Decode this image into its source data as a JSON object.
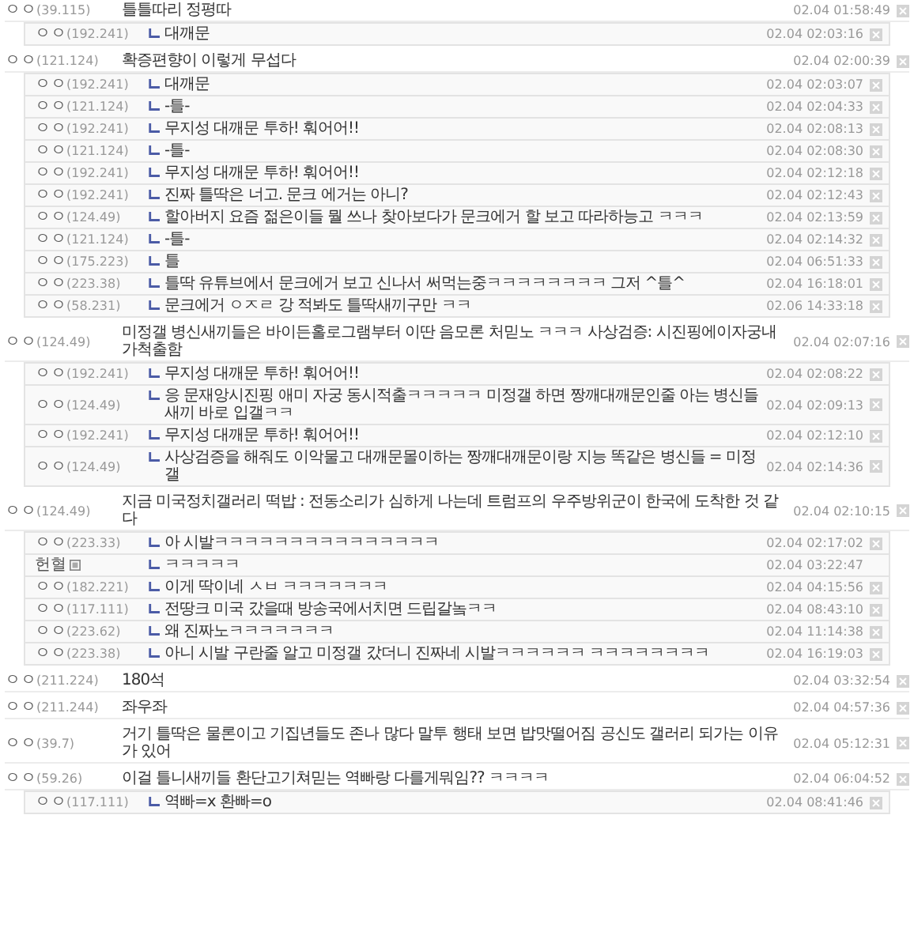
{
  "threads": [
    {
      "author": "ㅇㅇ",
      "ip": "(39.115)",
      "text": "틀틀따리 정평따",
      "time": "02.04 01:58:49",
      "deletable": true,
      "replies": [
        {
          "author": "ㅇㅇ",
          "ip": "(192.241)",
          "text": "대깨문",
          "time": "02.04 02:03:16",
          "deletable": true
        }
      ]
    },
    {
      "author": "ㅇㅇ",
      "ip": "(121.124)",
      "text": "확증편향이 이렇게 무섭다",
      "time": "02.04 02:00:39",
      "deletable": true,
      "replies": [
        {
          "author": "ㅇㅇ",
          "ip": "(192.241)",
          "text": "대깨문",
          "time": "02.04 02:03:07",
          "deletable": true
        },
        {
          "author": "ㅇㅇ",
          "ip": "(121.124)",
          "text": "-틀-",
          "time": "02.04 02:04:33",
          "deletable": true
        },
        {
          "author": "ㅇㅇ",
          "ip": "(192.241)",
          "text": "무지성 대깨문 투하! 훠어어!!",
          "time": "02.04 02:08:13",
          "deletable": true
        },
        {
          "author": "ㅇㅇ",
          "ip": "(121.124)",
          "text": "-틀-",
          "time": "02.04 02:08:30",
          "deletable": true
        },
        {
          "author": "ㅇㅇ",
          "ip": "(192.241)",
          "text": "무지성 대깨문 투하! 훠어어!!",
          "time": "02.04 02:12:18",
          "deletable": true
        },
        {
          "author": "ㅇㅇ",
          "ip": "(192.241)",
          "text": "진짜 틀딱은 너고. 문크 에거는 아니?",
          "time": "02.04 02:12:43",
          "deletable": true
        },
        {
          "author": "ㅇㅇ",
          "ip": "(124.49)",
          "text": "할아버지 요즘 젊은이들 뭘 쓰나 찾아보다가 문크에거 할 보고 따라하능고 ㅋㅋㅋ",
          "time": "02.04 02:13:59",
          "deletable": true
        },
        {
          "author": "ㅇㅇ",
          "ip": "(121.124)",
          "text": "-틀-",
          "time": "02.04 02:14:32",
          "deletable": true
        },
        {
          "author": "ㅇㅇ",
          "ip": "(175.223)",
          "text": "틀",
          "time": "02.04 06:51:33",
          "deletable": true
        },
        {
          "author": "ㅇㅇ",
          "ip": "(223.38)",
          "text": "틀딱 유튜브에서 문크에거 보고 신나서 써먹는중ㅋㅋㅋㅋㅋㅋㅋㅋ 그저 ^틀^",
          "time": "02.04 16:18:01",
          "deletable": true
        },
        {
          "author": "ㅇㅇ",
          "ip": "(58.231)",
          "text": "문크에거 ㅇㅈㄹ 강 적봐도 틀딱새끼구만 ㅋㅋ",
          "time": "02.06 14:33:18",
          "deletable": true
        }
      ]
    },
    {
      "author": "ㅇㅇ",
      "ip": "(124.49)",
      "text": "미정갤 병신새끼들은 바이든홀로그램부터 이딴 음모론 처믿노 ㅋㅋㅋ 사상검증: 시진핑에이자궁내가척출함",
      "time": "02.04 02:07:16",
      "deletable": true,
      "replies": [
        {
          "author": "ㅇㅇ",
          "ip": "(192.241)",
          "text": "무지성 대깨문 투하! 훠어어!!",
          "time": "02.04 02:08:22",
          "deletable": true
        },
        {
          "author": "ㅇㅇ",
          "ip": "(124.49)",
          "text": "응 문재앙시진핑 애미 자궁 동시적출ㅋㅋㅋㅋㅋ 미정갤 하면 짱깨대깨문인줄 아는 병신들새끼 바로 입갤ㅋㅋ",
          "time": "02.04 02:09:13",
          "deletable": true
        },
        {
          "author": "ㅇㅇ",
          "ip": "(192.241)",
          "text": "무지성 대깨문 투하! 훠어어!!",
          "time": "02.04 02:12:10",
          "deletable": true
        },
        {
          "author": "ㅇㅇ",
          "ip": "(124.49)",
          "text": "사상검증을 해줘도 이악물고 대깨문몰이하는 짱깨대깨문이랑 지능 똑같은 병신들 = 미정갤",
          "time": "02.04 02:14:36",
          "deletable": true
        }
      ]
    },
    {
      "author": "ㅇㅇ",
      "ip": "(124.49)",
      "text": "지금 미국정치갤러리 떡밥 : 전동소리가 심하게 나는데 트럼프의 우주방위군이 한국에 도착한 것 같다",
      "time": "02.04 02:10:15",
      "deletable": true,
      "replies": [
        {
          "author": "ㅇㅇ",
          "ip": "(223.33)",
          "text": "아 시발ㅋㅋㅋㅋㅋㅋㅋㅋㅋㅋㅋㅋㅋㅋㅋ",
          "time": "02.04 02:17:02",
          "deletable": true
        },
        {
          "author": "헌혈",
          "nick_icon": true,
          "text": "ㅋㅋㅋㅋㅋ",
          "time": "02.04 03:22:47",
          "deletable": false
        },
        {
          "author": "ㅇㅇ",
          "ip": "(182.221)",
          "text": "이게 딱이네 ㅅㅂ ㅋㅋㅋㅋㅋㅋㅋ",
          "time": "02.04 04:15:56",
          "deletable": true
        },
        {
          "author": "ㅇㅇ",
          "ip": "(117.111)",
          "text": "전땅크 미국 갔을때 방송국에서치면 드립갈놐ㅋㅋ",
          "time": "02.04 08:43:10",
          "deletable": true
        },
        {
          "author": "ㅇㅇ",
          "ip": "(223.62)",
          "text": "왜 진짜노ㅋㅋㅋㅋㅋㅋㅋ",
          "time": "02.04 11:14:38",
          "deletable": true
        },
        {
          "author": "ㅇㅇ",
          "ip": "(223.38)",
          "text": "아니 시발 구란줄 알고 미정갤 갔더니 진짜네 시발ㅋㅋㅋㅋㅋㅋ ㅋㅋㅋㅋㅋㅋㅋㅋ",
          "time": "02.04 16:19:03",
          "deletable": true
        }
      ]
    },
    {
      "author": "ㅇㅇ",
      "ip": "(211.224)",
      "text": "180석",
      "time": "02.04 03:32:54",
      "deletable": true
    },
    {
      "author": "ㅇㅇ",
      "ip": "(211.244)",
      "text": "좌우좌",
      "time": "02.04 04:57:36",
      "deletable": true
    },
    {
      "author": "ㅇㅇ",
      "ip": "(39.7)",
      "text": "거기 틀딱은 물론이고 기집년들도 존나 많다 말투 행태 보면 밥맛떨어짐 공신도 갤러리 되가는 이유가 있어",
      "time": "02.04 05:12:31",
      "deletable": true
    },
    {
      "author": "ㅇㅇ",
      "ip": "(59.26)",
      "text": "이걸 틀니새끼들 환단고기쳐믿는 역빠랑 다를게뭐임?? ㅋㅋㅋㅋ",
      "time": "02.04 06:04:52",
      "deletable": true,
      "replies": [
        {
          "author": "ㅇㅇ",
          "ip": "(117.111)",
          "text": "역빠=x 환빠=o",
          "time": "02.04 08:41:46",
          "deletable": true
        }
      ]
    }
  ]
}
